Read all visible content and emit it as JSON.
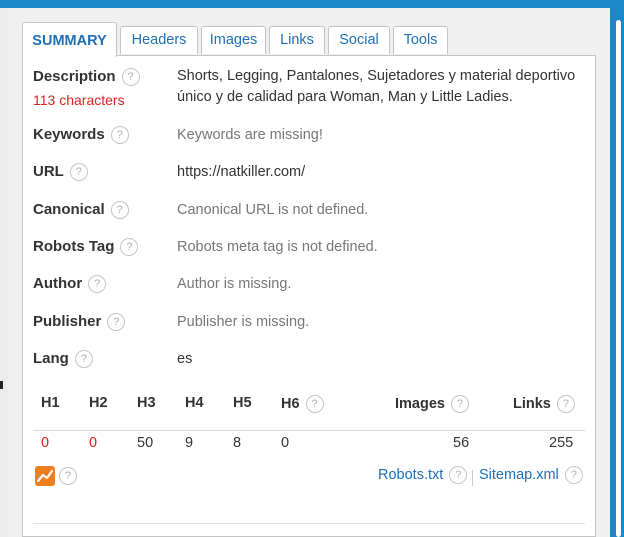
{
  "tabs": [
    {
      "label": "SUMMARY",
      "active": true
    },
    {
      "label": "Headers"
    },
    {
      "label": "Images"
    },
    {
      "label": "Links"
    },
    {
      "label": "Social"
    },
    {
      "label": "Tools"
    }
  ],
  "help_glyph": "?",
  "summary": {
    "description": {
      "label": "Description",
      "chars": "113 characters",
      "value": "Shorts, Legging, Pantalones, Sujetadores y material deportivo único y de calidad para Woman, Man y Little Ladies."
    },
    "keywords": {
      "label": "Keywords",
      "value": "Keywords are missing!"
    },
    "url": {
      "label": "URL",
      "value": "https://natkiller.com/"
    },
    "canonical": {
      "label": "Canonical",
      "value": "Canonical URL is not defined."
    },
    "robots": {
      "label": "Robots Tag",
      "value": "Robots meta tag is not defined."
    },
    "author": {
      "label": "Author",
      "value": "Author is missing."
    },
    "publisher": {
      "label": "Publisher",
      "value": "Publisher is missing."
    },
    "lang": {
      "label": "Lang",
      "value": "es"
    }
  },
  "stats": {
    "headers": [
      "H1",
      "H2",
      "H3",
      "H4",
      "H5",
      "H6",
      "Images",
      "Links"
    ],
    "values": [
      "0",
      "0",
      "50",
      "9",
      "8",
      "0",
      "56",
      "255"
    ]
  },
  "footer": {
    "robots_link": "Robots.txt",
    "sitemap_link": "Sitemap.xml"
  },
  "colors": {
    "accent": "#1a88c8",
    "link": "#1f6fb8",
    "warning": "#e02020",
    "trend_icon": "#f27d1c"
  },
  "icons": {
    "help": "help-icon",
    "trend": "trend-chart-icon"
  }
}
